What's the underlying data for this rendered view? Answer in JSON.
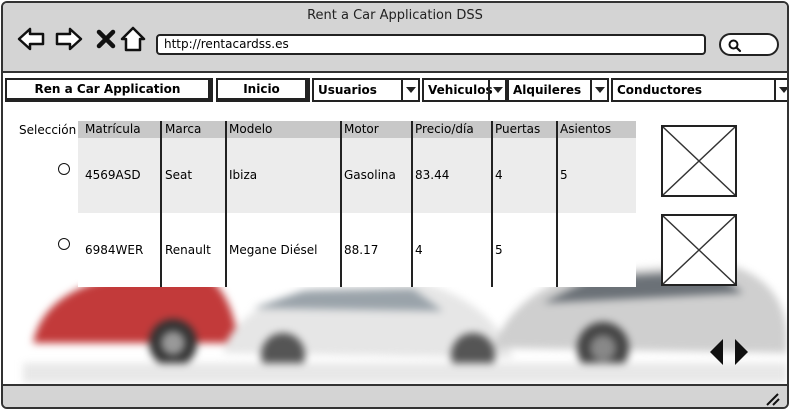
{
  "window": {
    "title": "Rent a Car Application DSS"
  },
  "browser": {
    "url": "http://rentacardss.es",
    "icons": [
      "back-arrow-icon",
      "forward-arrow-icon",
      "close-icon",
      "home-icon",
      "search-icon"
    ]
  },
  "menu": {
    "app_button": "Ren a Car Application",
    "inicio": "Inicio",
    "usuarios": "Usuarios",
    "vehiculos": "Vehiculos",
    "alquileres": "Alquileres",
    "conductores": "Conductores"
  },
  "table": {
    "selection_label": "Selección",
    "headers": [
      "Matrícula",
      "Marca",
      "Modelo",
      "Motor",
      "Precio/día",
      "Puertas",
      "Asientos"
    ],
    "rows": [
      [
        "4569ASD",
        "Seat",
        "Ibiza",
        "Gasolina",
        "83.44",
        "4",
        "5"
      ],
      [
        "6984WER",
        "Renault",
        "Megane Diésel",
        "88.17",
        "4",
        "5",
        ""
      ]
    ]
  },
  "colors": {
    "chrome": "#d4d4d4",
    "table_header": "#c8c8c8",
    "row_alt": "#ececec",
    "ink": "#222222"
  }
}
